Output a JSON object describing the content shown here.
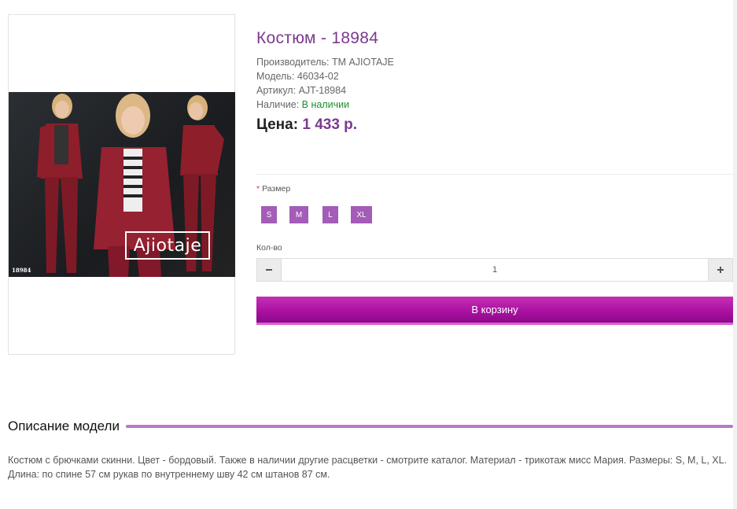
{
  "product": {
    "title": "Костюм - 18984",
    "manufacturer_label": "Производитель:",
    "manufacturer": "ТМ AJIOTAJE",
    "model_label": "Модель:",
    "model": "46034-02",
    "sku_label": "Артикул:",
    "sku": "AJT-18984",
    "availability_label": "Наличие:",
    "availability": "В наличии",
    "price_label": "Цена:",
    "price": "1 433 р."
  },
  "image": {
    "brand_logo": "Ajiotaje",
    "photo_code": "18984"
  },
  "options": {
    "required_mark": "*",
    "size_label": "Размер",
    "sizes": [
      "S",
      "M",
      "L",
      "XL"
    ],
    "qty_label": "Кол-во",
    "qty_value": "1",
    "minus_icon": "minus-icon",
    "plus_icon": "plus-icon"
  },
  "cart": {
    "button_label": "В корзину"
  },
  "description": {
    "heading": "Описание модели",
    "text": "Костюм с брючками скинни. Цвет - бордовый. Также в наличии другие расцветки - смотрите каталог. Материал - трикотаж мисс Мария. Размеры: S, M, L, XL. Длина: по спине 57 см рукав по внутреннему шву 42 см штанов 87 см."
  },
  "colors": {
    "accent": "#7b3a8e",
    "size_button": "#a35cb7",
    "cart_button": "#b01fa6",
    "in_stock": "#1d8d2a",
    "suit": "#8e1e2a"
  }
}
